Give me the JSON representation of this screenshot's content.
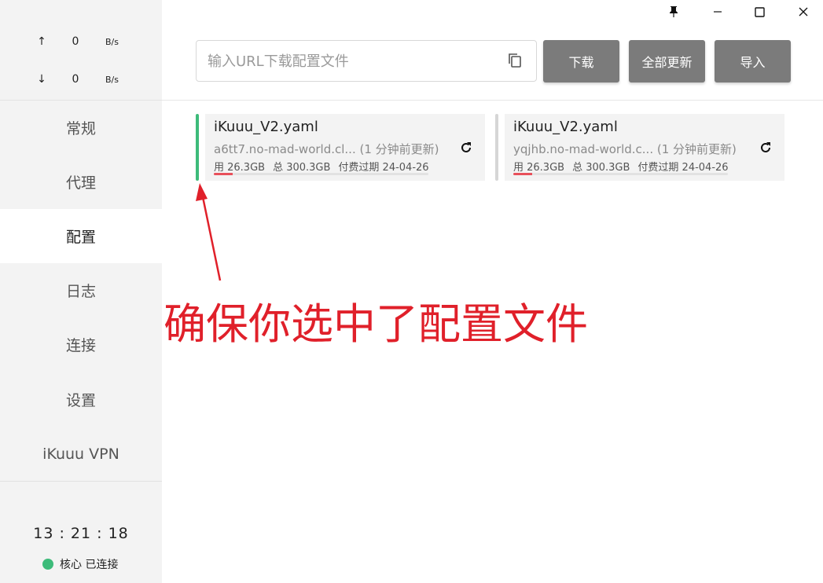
{
  "window": {
    "controls": {
      "pin": "pin-icon",
      "minimize": "minimize-icon",
      "maximize": "maximize-icon",
      "close": "close-icon"
    }
  },
  "traffic": {
    "upload": {
      "arrow": "↑",
      "value": "0",
      "unit": "B/s"
    },
    "download": {
      "arrow": "↓",
      "value": "0",
      "unit": "B/s"
    }
  },
  "sidebar": {
    "items": [
      {
        "label": "常规"
      },
      {
        "label": "代理"
      },
      {
        "label": "配置",
        "active": true
      },
      {
        "label": "日志"
      },
      {
        "label": "连接"
      },
      {
        "label": "设置"
      },
      {
        "label": "iKuuu VPN"
      }
    ],
    "clock": "13 : 21 : 18",
    "core_status": "核心 已连接",
    "core_color": "#3dbb7a"
  },
  "toolbar": {
    "url_placeholder": "输入URL下载配置文件",
    "download_label": "下载",
    "update_all_label": "全部更新",
    "import_label": "导入"
  },
  "profiles": [
    {
      "name": "iKuuu_V2.yaml",
      "url": "a6tt7.no-mad-world.cl...",
      "updated": "(1 分钟前更新)",
      "used": "用 26.3GB",
      "total": "总 300.3GB",
      "expire": "付费过期 24-04-26",
      "usage_fraction": 0.088,
      "selected": true
    },
    {
      "name": "iKuuu_V2.yaml",
      "url": "yqjhb.no-mad-world.c...",
      "updated": "(1 分钟前更新)",
      "used": "用 26.3GB",
      "total": "总 300.3GB",
      "expire": "付费过期 24-04-26",
      "usage_fraction": 0.088,
      "selected": false
    }
  ],
  "annotation": {
    "text": "确保你选中了配置文件",
    "color": "#e0202a"
  },
  "colors": {
    "accent_selected": "#3dbb7a",
    "unselected_bar": "#d6d6d6",
    "button_bg": "#7b7b7b",
    "progress": "#e8505b"
  }
}
